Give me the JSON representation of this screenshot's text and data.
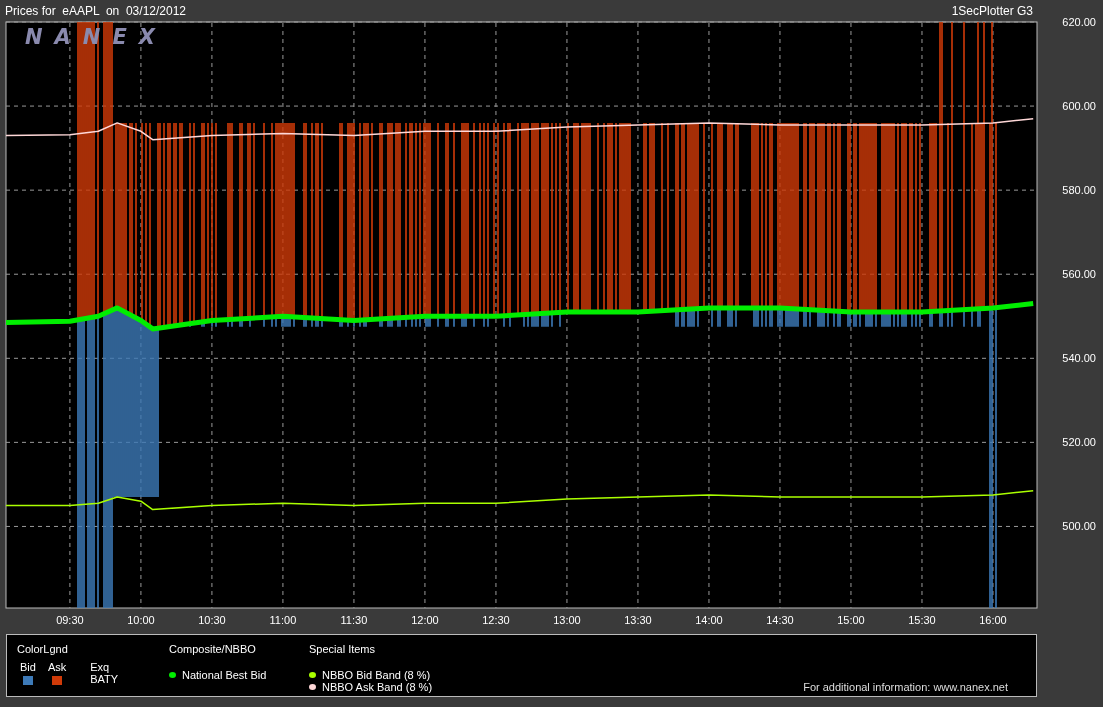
{
  "header": {
    "title": "Prices for  eAAPL  on  03/12/2012",
    "app": "1SecPlotter G3"
  },
  "logo": "NANEX",
  "chart": {
    "chart_data": {
      "type": "line",
      "grid": true,
      "xlim": [
        543,
        978.6
      ],
      "ylim": [
        480.6,
        620
      ],
      "xticks": [
        {
          "value": 570,
          "label": "09:30"
        },
        {
          "value": 600,
          "label": "10:00"
        },
        {
          "value": 630,
          "label": "10:30"
        },
        {
          "value": 660,
          "label": "11:00"
        },
        {
          "value": 690,
          "label": "11:30"
        },
        {
          "value": 720,
          "label": "12:00"
        },
        {
          "value": 750,
          "label": "12:30"
        },
        {
          "value": 780,
          "label": "13:00"
        },
        {
          "value": 810,
          "label": "13:30"
        },
        {
          "value": 840,
          "label": "14:00"
        },
        {
          "value": 870,
          "label": "14:30"
        },
        {
          "value": 900,
          "label": "15:00"
        },
        {
          "value": 930,
          "label": "15:30"
        },
        {
          "value": 960,
          "label": "16:00"
        }
      ],
      "yticks": [
        {
          "value": 500,
          "label": "500.00"
        },
        {
          "value": 520,
          "label": "520.00"
        },
        {
          "value": 540,
          "label": "540.00"
        },
        {
          "value": 560,
          "label": "560.00"
        },
        {
          "value": 580,
          "label": "580.00"
        },
        {
          "value": 600,
          "label": "600.00"
        },
        {
          "value": 620,
          "label": "620.00"
        }
      ],
      "x": [
        543,
        570,
        582,
        590,
        600,
        605,
        630,
        660,
        690,
        720,
        750,
        780,
        810,
        840,
        870,
        900,
        930,
        960,
        977
      ],
      "series": [
        {
          "name": "National Best Bid",
          "color": "#00ee00",
          "values": [
            548.5,
            548.8,
            550,
            552,
            549,
            547,
            549,
            550,
            549,
            550,
            550,
            551,
            551,
            552,
            552,
            551,
            551,
            552,
            553
          ]
        },
        {
          "name": "NBBO Bid Band (8 %)",
          "color": "#aaff00",
          "values": [
            505,
            505,
            505.5,
            507,
            506,
            504,
            505,
            505.5,
            505,
            505.5,
            505.5,
            506.5,
            507,
            507.5,
            507,
            507,
            507,
            507.5,
            508.5
          ]
        },
        {
          "name": "NBBO Ask Band (8 %)",
          "color": "#ffd8d8",
          "values": [
            593,
            593.2,
            594,
            596,
            594,
            592,
            593,
            593.5,
            593,
            594,
            594,
            595,
            595.5,
            596,
            595.5,
            595.5,
            595.5,
            596,
            597
          ]
        }
      ]
    }
  },
  "legend": {
    "color_legend": {
      "title": "ColorLgnd",
      "items": [
        {
          "label": "Bid",
          "color": "#3d7ab8"
        },
        {
          "label": "Ask",
          "color": "#d03a08"
        }
      ],
      "exchange_title": "Exq",
      "exchange": "BATY"
    },
    "composite": {
      "title": "Composite/NBBO"
    },
    "special": {
      "title": "Special Items"
    },
    "footer": "For additional information: www.nanex.net"
  }
}
